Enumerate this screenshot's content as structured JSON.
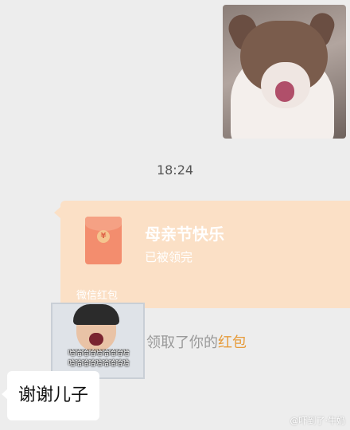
{
  "conversation": {
    "timestamp": "18:24",
    "red_packet": {
      "title": "母亲节快乐",
      "status": "已被领完",
      "label": "微信红包",
      "seal_glyph": "¥",
      "color": "#fbe0c6"
    },
    "notice": {
      "prefix": "领取了你的",
      "highlight": "红包"
    },
    "meme": {
      "line1": "哈哈哈哈哈哈哈哈哈",
      "line2": "哈哈哈哈哈哈哈哈哈"
    },
    "reply": "谢谢儿子"
  },
  "watermark": "@吓到了·牛奶"
}
